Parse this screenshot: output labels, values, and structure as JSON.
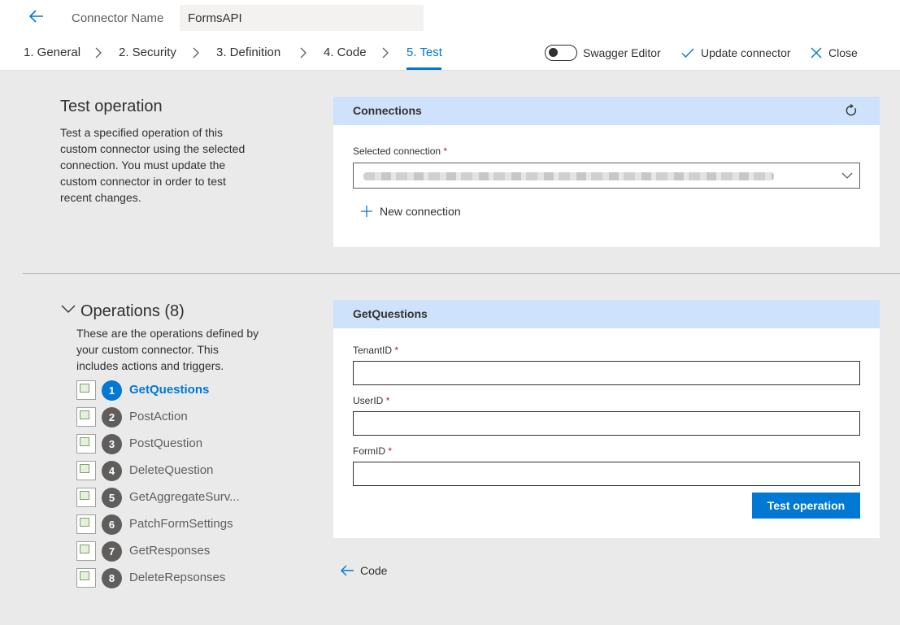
{
  "header": {
    "connector_name_label": "Connector Name",
    "connector_name_value": "FormsAPI"
  },
  "steps": [
    {
      "label": "1. General"
    },
    {
      "label": "2. Security"
    },
    {
      "label": "3. Definition"
    },
    {
      "label": "4. Code"
    },
    {
      "label": "5. Test",
      "active": true
    }
  ],
  "toolbar": {
    "swagger_editor": "Swagger Editor",
    "swagger_enabled": false,
    "update_connector": "Update connector",
    "close": "Close"
  },
  "test_operation": {
    "title": "Test operation",
    "description": "Test a specified operation of this custom connector using the selected connection. You must update the custom connector in order to test recent changes."
  },
  "connections": {
    "header": "Connections",
    "selected_label": "Selected connection",
    "required_mark": "*",
    "new_connection": "New connection"
  },
  "operations": {
    "title": "Operations (8)",
    "description": "These are the operations defined by your custom connector. This includes actions and triggers.",
    "items": [
      {
        "num": "1",
        "name": "GetQuestions",
        "active": true
      },
      {
        "num": "2",
        "name": "PostAction"
      },
      {
        "num": "3",
        "name": "PostQuestion"
      },
      {
        "num": "4",
        "name": "DeleteQuestion"
      },
      {
        "num": "5",
        "name": "GetAggregateSurv..."
      },
      {
        "num": "6",
        "name": "PatchFormSettings"
      },
      {
        "num": "7",
        "name": "GetResponses"
      },
      {
        "num": "8",
        "name": "DeleteRepsonses"
      }
    ]
  },
  "get_questions": {
    "header": "GetQuestions",
    "fields": [
      {
        "label": "TenantID",
        "value": ""
      },
      {
        "label": "UserID",
        "value": ""
      },
      {
        "label": "FormID",
        "value": ""
      }
    ],
    "required_mark": "*",
    "test_button": "Test operation"
  },
  "footer": {
    "back_code": "Code"
  },
  "colors": {
    "accent": "#0078d4",
    "card_header": "#cfe2fb",
    "background": "#eaeaea"
  }
}
